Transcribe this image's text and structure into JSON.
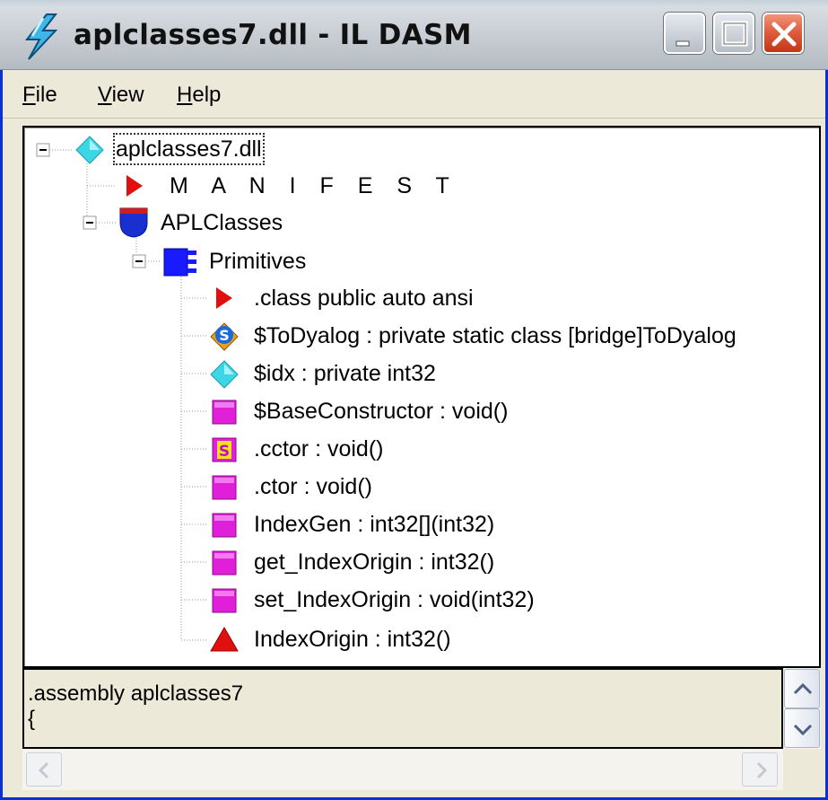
{
  "window": {
    "title": "aplclasses7.dll - IL DASM",
    "icon": "lightning-bolt-icon"
  },
  "titlebar_buttons": {
    "minimize_icon": "minimize-icon",
    "maximize_icon": "maximize-icon",
    "close_icon": "close-icon"
  },
  "menu": {
    "file": {
      "accel": "F",
      "rest": "ile"
    },
    "view": {
      "accel": "V",
      "rest": "iew"
    },
    "help": {
      "accel": "H",
      "rest": "elp"
    }
  },
  "tree": {
    "nodes": [
      {
        "label": "aplclasses7.dll",
        "icon": "cyan-diamond",
        "expander": "minus",
        "selected": true
      },
      {
        "label": "M A N I F E S T",
        "icon": "red-triangle-right"
      },
      {
        "label": "APLClasses",
        "icon": "blue-shield",
        "expander": "minus"
      },
      {
        "label": "Primitives",
        "icon": "blue-class",
        "expander": "minus"
      },
      {
        "label": ".class public auto ansi",
        "icon": "red-triangle-right"
      },
      {
        "label": "$ToDyalog : private static class [bridge]ToDyalog",
        "icon": "static-field"
      },
      {
        "label": "$idx : private int32",
        "icon": "cyan-diamond"
      },
      {
        "label": "$BaseConstructor : void()",
        "icon": "magenta-method"
      },
      {
        "label": ".cctor : void()",
        "icon": "static-method"
      },
      {
        "label": ".ctor : void()",
        "icon": "magenta-method"
      },
      {
        "label": "IndexGen : int32[](int32)",
        "icon": "magenta-method"
      },
      {
        "label": "get_IndexOrigin : int32()",
        "icon": "magenta-method"
      },
      {
        "label": "set_IndexOrigin : void(int32)",
        "icon": "magenta-method"
      },
      {
        "label": "IndexOrigin : int32()",
        "icon": "red-triangle-up"
      }
    ]
  },
  "info": {
    "lines": [
      ".assembly aplclasses7",
      "{"
    ]
  },
  "colors": {
    "titlebar": "#c9d0d6",
    "close_button": "#d9502e",
    "window_border": "#0831d9",
    "method": "#e020d8",
    "field": "#3dd6e6",
    "class": "#1a1aff",
    "red": "#e01010"
  }
}
